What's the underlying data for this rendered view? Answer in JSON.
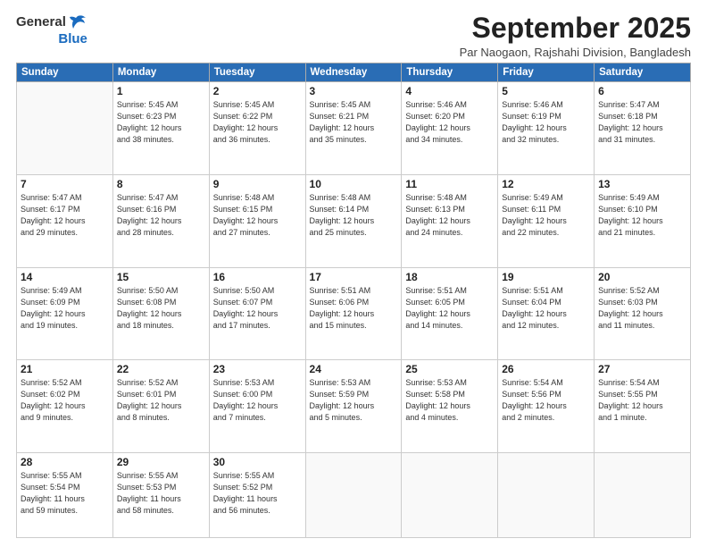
{
  "logo": {
    "text1": "General",
    "text2": "Blue"
  },
  "title": "September 2025",
  "subtitle": "Par Naogaon, Rajshahi Division, Bangladesh",
  "days_header": [
    "Sunday",
    "Monday",
    "Tuesday",
    "Wednesday",
    "Thursday",
    "Friday",
    "Saturday"
  ],
  "weeks": [
    [
      {
        "day": "",
        "info": ""
      },
      {
        "day": "1",
        "info": "Sunrise: 5:45 AM\nSunset: 6:23 PM\nDaylight: 12 hours\nand 38 minutes."
      },
      {
        "day": "2",
        "info": "Sunrise: 5:45 AM\nSunset: 6:22 PM\nDaylight: 12 hours\nand 36 minutes."
      },
      {
        "day": "3",
        "info": "Sunrise: 5:45 AM\nSunset: 6:21 PM\nDaylight: 12 hours\nand 35 minutes."
      },
      {
        "day": "4",
        "info": "Sunrise: 5:46 AM\nSunset: 6:20 PM\nDaylight: 12 hours\nand 34 minutes."
      },
      {
        "day": "5",
        "info": "Sunrise: 5:46 AM\nSunset: 6:19 PM\nDaylight: 12 hours\nand 32 minutes."
      },
      {
        "day": "6",
        "info": "Sunrise: 5:47 AM\nSunset: 6:18 PM\nDaylight: 12 hours\nand 31 minutes."
      }
    ],
    [
      {
        "day": "7",
        "info": "Sunrise: 5:47 AM\nSunset: 6:17 PM\nDaylight: 12 hours\nand 29 minutes."
      },
      {
        "day": "8",
        "info": "Sunrise: 5:47 AM\nSunset: 6:16 PM\nDaylight: 12 hours\nand 28 minutes."
      },
      {
        "day": "9",
        "info": "Sunrise: 5:48 AM\nSunset: 6:15 PM\nDaylight: 12 hours\nand 27 minutes."
      },
      {
        "day": "10",
        "info": "Sunrise: 5:48 AM\nSunset: 6:14 PM\nDaylight: 12 hours\nand 25 minutes."
      },
      {
        "day": "11",
        "info": "Sunrise: 5:48 AM\nSunset: 6:13 PM\nDaylight: 12 hours\nand 24 minutes."
      },
      {
        "day": "12",
        "info": "Sunrise: 5:49 AM\nSunset: 6:11 PM\nDaylight: 12 hours\nand 22 minutes."
      },
      {
        "day": "13",
        "info": "Sunrise: 5:49 AM\nSunset: 6:10 PM\nDaylight: 12 hours\nand 21 minutes."
      }
    ],
    [
      {
        "day": "14",
        "info": "Sunrise: 5:49 AM\nSunset: 6:09 PM\nDaylight: 12 hours\nand 19 minutes."
      },
      {
        "day": "15",
        "info": "Sunrise: 5:50 AM\nSunset: 6:08 PM\nDaylight: 12 hours\nand 18 minutes."
      },
      {
        "day": "16",
        "info": "Sunrise: 5:50 AM\nSunset: 6:07 PM\nDaylight: 12 hours\nand 17 minutes."
      },
      {
        "day": "17",
        "info": "Sunrise: 5:51 AM\nSunset: 6:06 PM\nDaylight: 12 hours\nand 15 minutes."
      },
      {
        "day": "18",
        "info": "Sunrise: 5:51 AM\nSunset: 6:05 PM\nDaylight: 12 hours\nand 14 minutes."
      },
      {
        "day": "19",
        "info": "Sunrise: 5:51 AM\nSunset: 6:04 PM\nDaylight: 12 hours\nand 12 minutes."
      },
      {
        "day": "20",
        "info": "Sunrise: 5:52 AM\nSunset: 6:03 PM\nDaylight: 12 hours\nand 11 minutes."
      }
    ],
    [
      {
        "day": "21",
        "info": "Sunrise: 5:52 AM\nSunset: 6:02 PM\nDaylight: 12 hours\nand 9 minutes."
      },
      {
        "day": "22",
        "info": "Sunrise: 5:52 AM\nSunset: 6:01 PM\nDaylight: 12 hours\nand 8 minutes."
      },
      {
        "day": "23",
        "info": "Sunrise: 5:53 AM\nSunset: 6:00 PM\nDaylight: 12 hours\nand 7 minutes."
      },
      {
        "day": "24",
        "info": "Sunrise: 5:53 AM\nSunset: 5:59 PM\nDaylight: 12 hours\nand 5 minutes."
      },
      {
        "day": "25",
        "info": "Sunrise: 5:53 AM\nSunset: 5:58 PM\nDaylight: 12 hours\nand 4 minutes."
      },
      {
        "day": "26",
        "info": "Sunrise: 5:54 AM\nSunset: 5:56 PM\nDaylight: 12 hours\nand 2 minutes."
      },
      {
        "day": "27",
        "info": "Sunrise: 5:54 AM\nSunset: 5:55 PM\nDaylight: 12 hours\nand 1 minute."
      }
    ],
    [
      {
        "day": "28",
        "info": "Sunrise: 5:55 AM\nSunset: 5:54 PM\nDaylight: 11 hours\nand 59 minutes."
      },
      {
        "day": "29",
        "info": "Sunrise: 5:55 AM\nSunset: 5:53 PM\nDaylight: 11 hours\nand 58 minutes."
      },
      {
        "day": "30",
        "info": "Sunrise: 5:55 AM\nSunset: 5:52 PM\nDaylight: 11 hours\nand 56 minutes."
      },
      {
        "day": "",
        "info": ""
      },
      {
        "day": "",
        "info": ""
      },
      {
        "day": "",
        "info": ""
      },
      {
        "day": "",
        "info": ""
      }
    ]
  ]
}
